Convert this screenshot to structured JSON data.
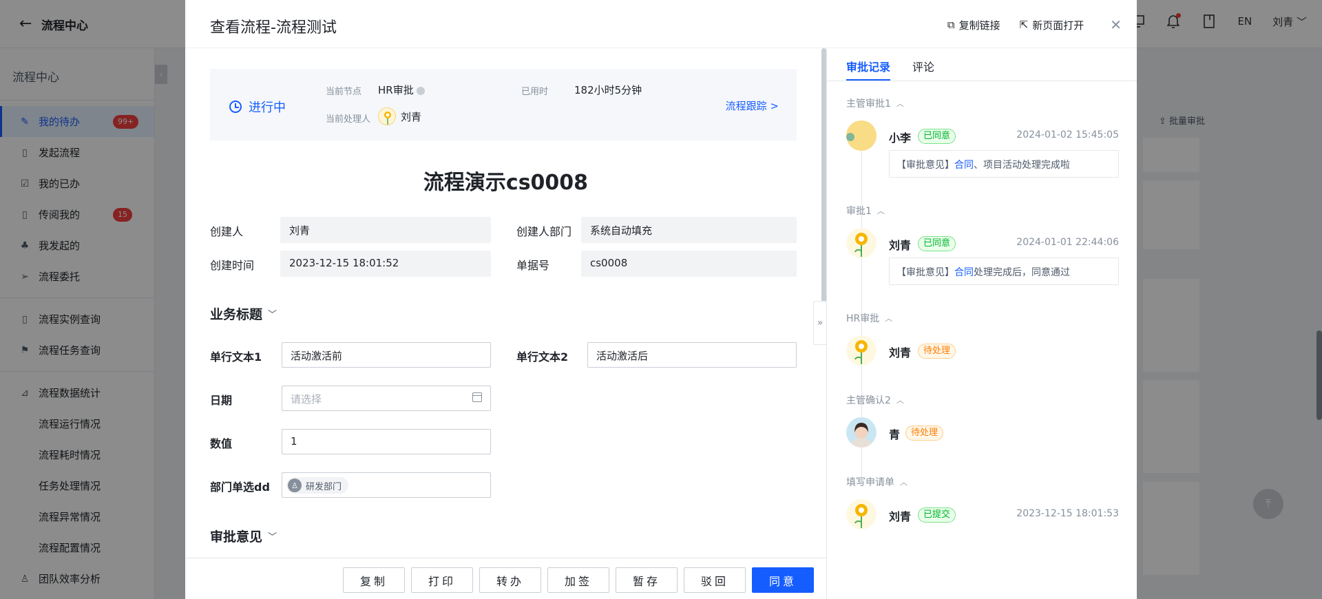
{
  "topbar": {
    "title": "流程中心",
    "lang": "EN",
    "user": "刘青"
  },
  "sidebar": {
    "title": "流程中心",
    "groups": [
      [
        {
          "label": "我的待办",
          "badge": "99+"
        },
        {
          "label": "发起流程"
        },
        {
          "label": "我的已办"
        },
        {
          "label": "传阅我的",
          "badge": "15"
        },
        {
          "label": "我发起的"
        },
        {
          "label": "流程委托"
        }
      ],
      [
        {
          "label": "流程实例查询"
        },
        {
          "label": "流程任务查询"
        }
      ],
      [
        {
          "label": "流程数据统计"
        },
        {
          "label": "流程运行情况"
        },
        {
          "label": "流程耗时情况"
        },
        {
          "label": "任务处理情况"
        },
        {
          "label": "流程异常情况"
        },
        {
          "label": "流程配置情况"
        },
        {
          "label": "团队效率分析"
        }
      ]
    ]
  },
  "background": {
    "batch_label": "批量审批"
  },
  "modal": {
    "title": "查看流程-流程测试",
    "copy_link": "复制链接",
    "open_new": "新页面打开"
  },
  "status": {
    "state": "进行中",
    "node_label": "当前节点",
    "node_value": "HR审批",
    "handler_label": "当前处理人",
    "handler_value": "刘青",
    "elapsed_label": "已用时",
    "elapsed_value": "182小时5分钟",
    "track_link": "流程跟踪 >"
  },
  "form": {
    "title": "流程演示cs0008",
    "creator_label": "创建人",
    "creator_value": "刘青",
    "dept_label": "创建人部门",
    "dept_value": "系统自动填充",
    "created_label": "创建时间",
    "created_value": "2023-12-15 18:01:52",
    "doc_label": "单据号",
    "doc_value": "cs0008",
    "section_business": "业务标题",
    "text1_label": "单行文本1",
    "text1_value": "活动激活前",
    "text2_label": "单行文本2",
    "text2_value": "活动激活后",
    "date_label": "日期",
    "date_placeholder": "请选择",
    "number_label": "数值",
    "number_value": "1",
    "deptsel_label": "部门单选dd",
    "deptsel_value": "研发部门",
    "section_opinion": "审批意见"
  },
  "buttons": {
    "copy": "复制",
    "print": "打印",
    "transfer": "转办",
    "addsign": "加签",
    "save": "暂存",
    "reject": "驳回",
    "agree": "同意"
  },
  "right": {
    "tab_records": "审批记录",
    "tab_comments": "评论",
    "timeline": [
      {
        "node": "主管审批1",
        "name": "小李",
        "status": "已同意",
        "time": "2024-01-02 15:45:05",
        "comment_prefix": "【审批意见】",
        "comment_link": "合同",
        "comment_rest": "、项目活动处理完成啦"
      },
      {
        "node": "审批1",
        "name": "刘青",
        "status": "已同意",
        "time": "2024-01-01 22:44:06",
        "comment_prefix": "【审批意见】",
        "comment_link": "合同",
        "comment_rest": "处理完成后，同意通过"
      },
      {
        "node": "HR审批",
        "name": "刘青",
        "status": "待处理"
      },
      {
        "node": "主管确认2",
        "name": "青",
        "status": "待处理"
      },
      {
        "node": "填写申请单",
        "name": "刘青",
        "status": "已提交",
        "time": "2023-12-15 18:01:53"
      }
    ]
  },
  "colors": {
    "primary": "#165dff",
    "success": "#00b42a",
    "warning": "#ff7d00",
    "danger": "#f53f3f"
  }
}
